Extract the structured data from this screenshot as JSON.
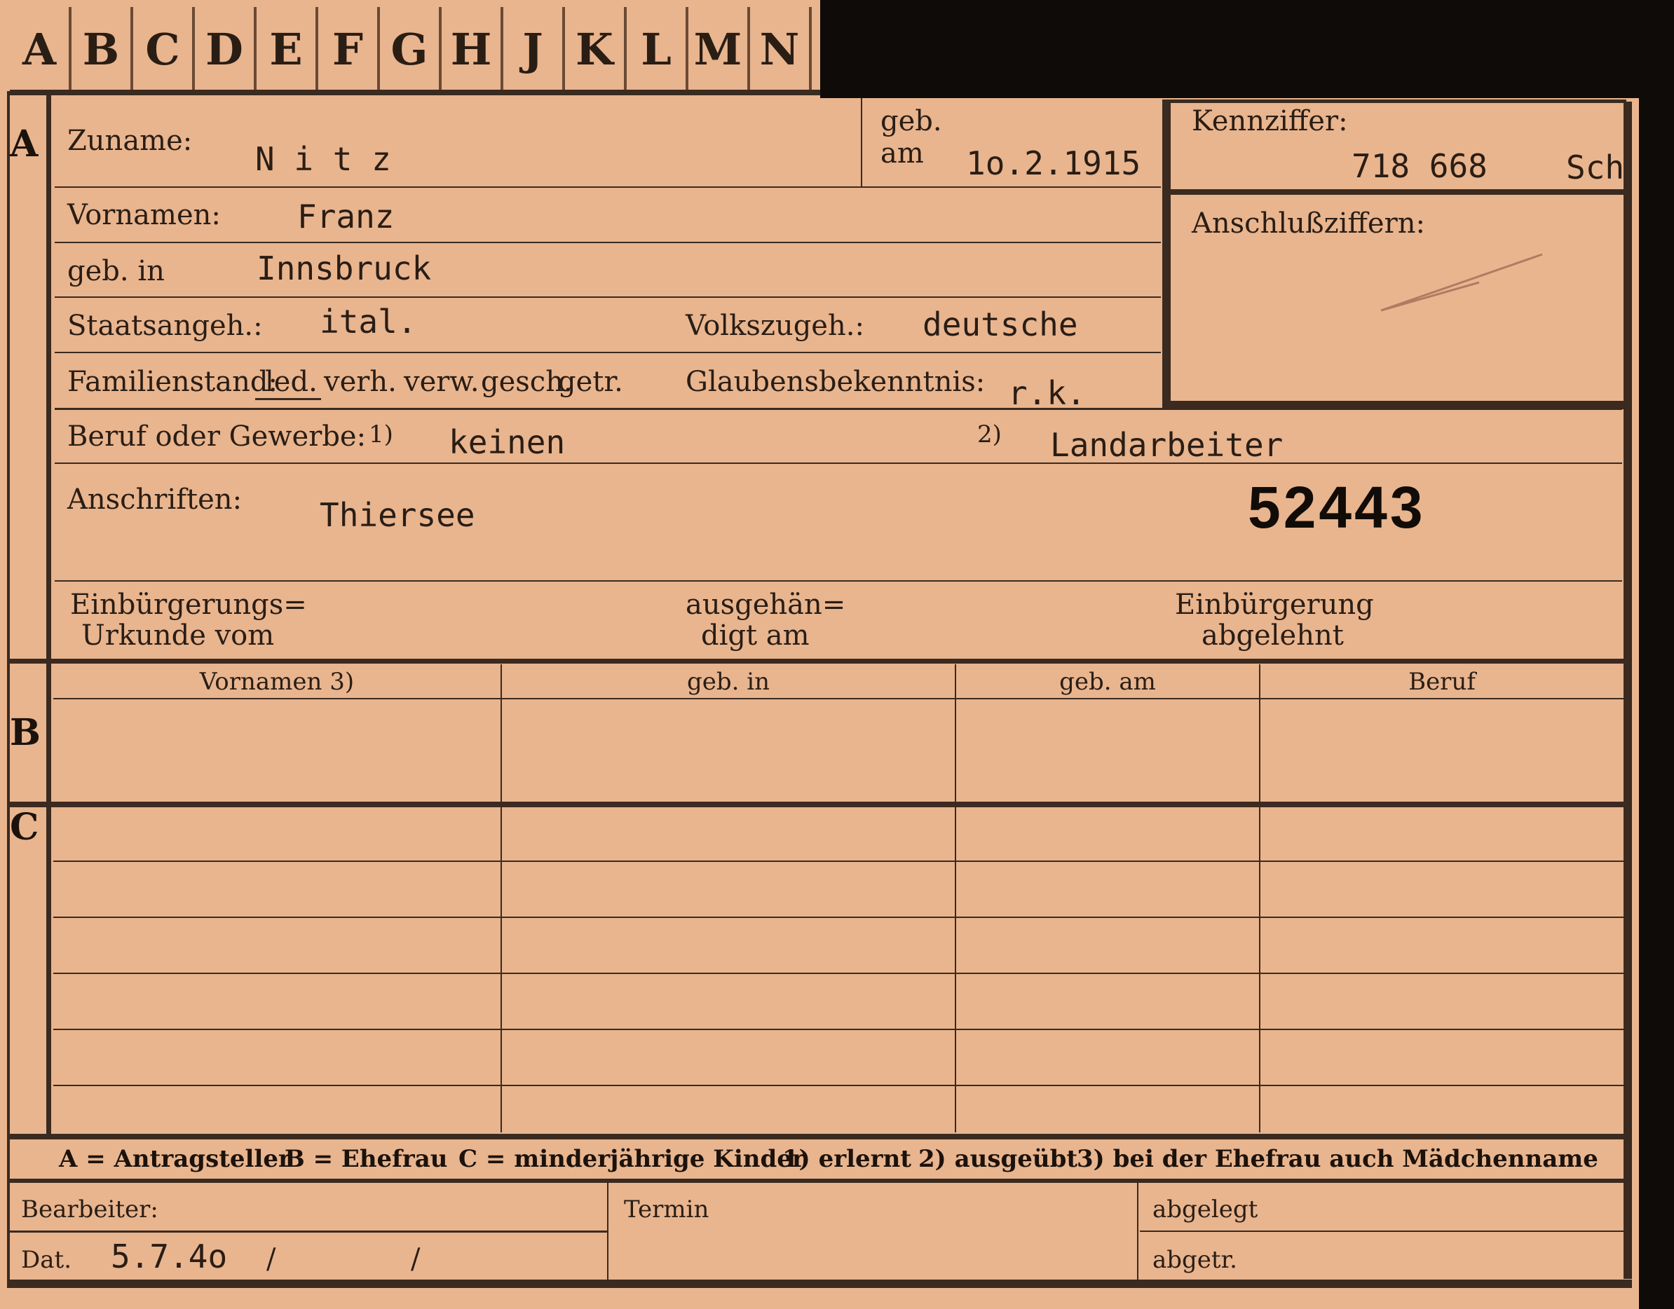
{
  "tabs": [
    "A",
    "B",
    "C",
    "D",
    "E",
    "F",
    "G",
    "H",
    "J",
    "K",
    "L",
    "M",
    "N"
  ],
  "sections": {
    "a": "A",
    "b": "B",
    "c": "C"
  },
  "section_a": {
    "zuname_label": "Zuname:",
    "zuname_value": "N i t z",
    "geb_label_1": "geb.",
    "geb_label_2": "am",
    "geb_am_value": "1o.2.1915",
    "vornamen_label": "Vornamen:",
    "vornamen_value": "Franz",
    "geb_in_label": "geb. in",
    "geb_in_value": "Innsbruck",
    "staatsangeh_label": "Staatsangeh.:",
    "staatsangeh_value": "ital.",
    "volkszugeh_label": "Volkszugeh.:",
    "volkszugeh_value": "deutsche",
    "familienstand_label": "Familienstand:",
    "familienstand_options": [
      "led.",
      "verh.",
      "verw.",
      "gesch.",
      "getr."
    ],
    "familienstand_selected": "led.",
    "glaubens_label": "Glaubensbekenntnis:",
    "glaubens_value": "r.k.",
    "beruf_label": "Beruf oder Gewerbe:",
    "beruf_note1": "1)",
    "beruf_value1": "keinen",
    "beruf_note2": "2)",
    "beruf_value2": "Landarbeiter",
    "anschriften_label": "Anschriften:",
    "anschriften_value": "Thiersee",
    "stamp_number": "52443",
    "einb_urkunde_label_1": "Einbürgerungs=",
    "einb_urkunde_label_2": "Urkunde vom",
    "ausgehaendigt_label_1": "ausgehän=",
    "ausgehaendigt_label_2": "digt am",
    "einb_abgelehnt_label_1": "Einbürgerung",
    "einb_abgelehnt_label_2": "abgelehnt"
  },
  "kennziffer": {
    "label": "Kennziffer:",
    "value": "718 668",
    "suffix": "Sch",
    "anschluss_label": "Anschlußziffern:"
  },
  "table_headers": [
    "Vornamen 3)",
    "geb. in",
    "geb. am",
    "Beruf"
  ],
  "legend": {
    "a": "A = Antragsteller",
    "b": "B = Ehefrau",
    "c": "C = minderjährige Kinder",
    "n1": "1) erlernt",
    "n2": "2) ausgeübt",
    "n3": "3) bei der Ehefrau auch Mädchenname"
  },
  "bottom": {
    "bearbeiter_label": "Bearbeiter:",
    "dat_label": "Dat.",
    "dat_value": "5.7.4o",
    "slash1": "/",
    "slash2": "/",
    "termin_label": "Termin",
    "abgelegt_label": "abgelegt",
    "abgetr_label": "abgetr."
  },
  "colors": {
    "card": "#e8b58f",
    "ink": "#2a1d14",
    "rule": "#3b2a1f",
    "background": "#0e0b08"
  }
}
